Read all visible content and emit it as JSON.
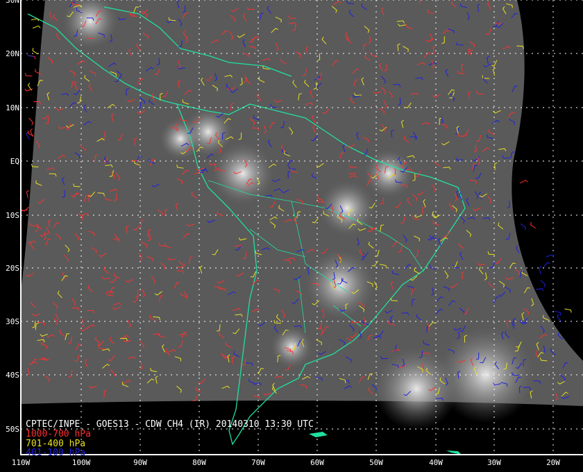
{
  "title": "CPTEC/INPE - GOES13 - CDW CH4 (IR) 20140310 13:30 UTC",
  "legend": [
    {
      "label": "1000-700 hPa",
      "color": "#ff3030"
    },
    {
      "label": "701-400 hPa",
      "color": "#e8e020"
    },
    {
      "label": "401-100 hPa",
      "color": "#2020e0"
    }
  ],
  "lat_labels": [
    "30N",
    "20N",
    "10N",
    "EQ",
    "10S",
    "20S",
    "30S",
    "40S",
    "50S"
  ],
  "lon_labels": [
    "110W",
    "100W",
    "90W",
    "80W",
    "70W",
    "60W",
    "50W",
    "40W",
    "30W",
    "20W"
  ],
  "colors": {
    "coast": "#20e0a0",
    "grid": "#ffffff",
    "frame": "#ffffff"
  }
}
